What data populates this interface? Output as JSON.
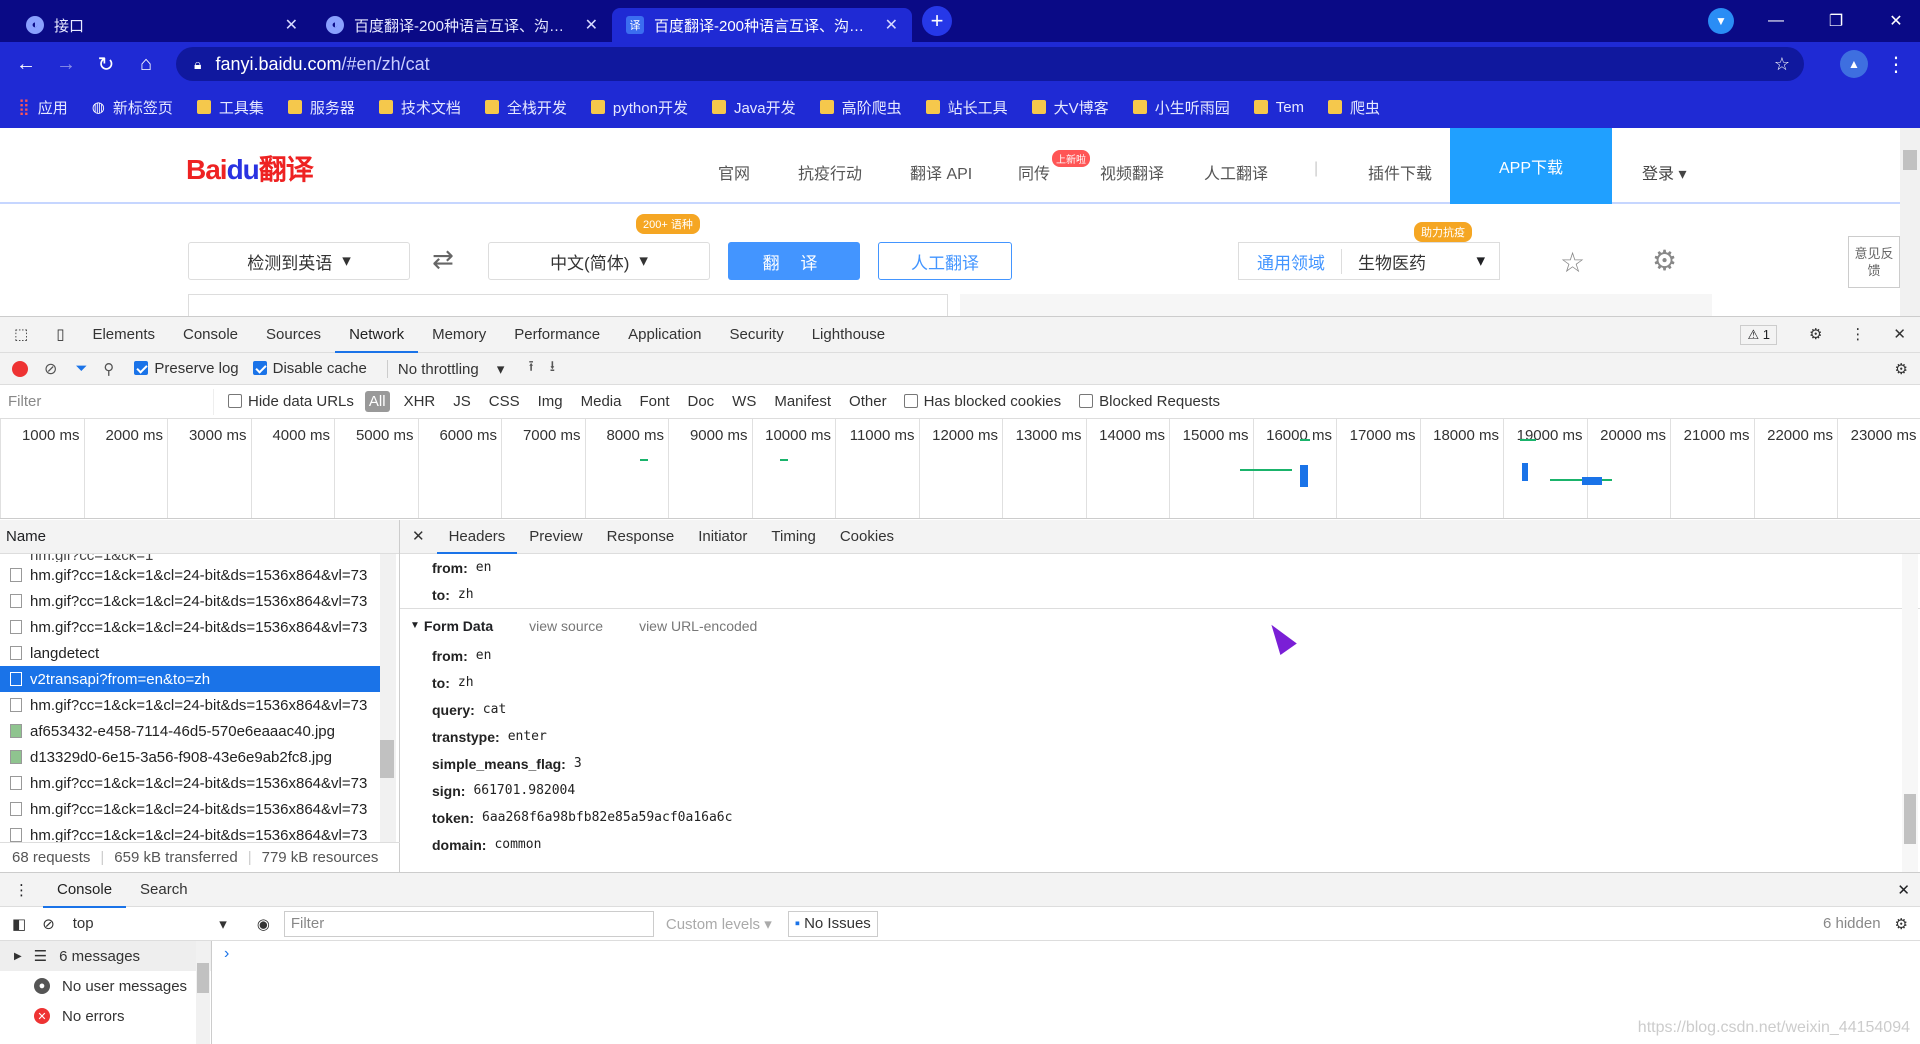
{
  "tabs": [
    {
      "title": "接口",
      "icon": "globe-icon"
    },
    {
      "title": "百度翻译-200种语言互译、沟通全世界",
      "icon": "globe-icon"
    },
    {
      "title": "百度翻译-200种语言互译、沟通全世界",
      "icon": "translate-favicon",
      "active": true
    }
  ],
  "address": {
    "host": "fanyi.baidu.com",
    "path": "/#en/zh/cat"
  },
  "bookmarks": [
    "应用",
    "新标签页",
    "工具集",
    "服务器",
    "技术文档",
    "全栈开发",
    "python开发",
    "Java开发",
    "高阶爬虫",
    "站长工具",
    "大V博客",
    "小生听雨园",
    "Tem",
    "爬虫"
  ],
  "site": {
    "logo_bai": "Bai",
    "logo_du": "du",
    "logo_fanyi": "翻译",
    "nav": [
      "官网",
      "抗疫行动",
      "翻译 API",
      "同传",
      "视频翻译",
      "人工翻译",
      "插件下载"
    ],
    "hot_badge": "上新啦",
    "app_download": "APP下载",
    "login": "登录",
    "from_lang": "检测到英语",
    "to_lang": "中文(简体)",
    "lang_badge": "200+ 语种",
    "translate_btn": "翻 译",
    "human_btn": "人工翻译",
    "domain_label": "通用领域",
    "domain_value": "生物医药",
    "domain_badge": "助力抗疫",
    "feedback": "意见反馈"
  },
  "devtools": {
    "tabs": [
      "Elements",
      "Console",
      "Sources",
      "Network",
      "Memory",
      "Performance",
      "Application",
      "Security",
      "Lighthouse"
    ],
    "active_tab": "Network",
    "warnings": "1",
    "preserve_log": "Preserve log",
    "disable_cache": "Disable cache",
    "throttling": "No throttling",
    "filter_placeholder": "Filter",
    "hide_data_urls": "Hide data URLs",
    "types": [
      "All",
      "XHR",
      "JS",
      "CSS",
      "Img",
      "Media",
      "Font",
      "Doc",
      "WS",
      "Manifest",
      "Other"
    ],
    "has_blocked": "Has blocked cookies",
    "blocked_requests": "Blocked Requests",
    "ticks": [
      "1000 ms",
      "2000 ms",
      "3000 ms",
      "4000 ms",
      "5000 ms",
      "6000 ms",
      "7000 ms",
      "8000 ms",
      "9000 ms",
      "10000 ms",
      "11000 ms",
      "12000 ms",
      "13000 ms",
      "14000 ms",
      "15000 ms",
      "16000 ms",
      "17000 ms",
      "18000 ms",
      "19000 ms",
      "20000 ms",
      "21000 ms",
      "22000 ms",
      "23000 ms"
    ],
    "name_header": "Name",
    "requests": [
      {
        "name": "hm.gif?cc=1&ck=1&cl=24-bit&ds=1536x864&vl=73"
      },
      {
        "name": "hm.gif?cc=1&ck=1&cl=24-bit&ds=1536x864&vl=73"
      },
      {
        "name": "hm.gif?cc=1&ck=1&cl=24-bit&ds=1536x864&vl=73"
      },
      {
        "name": "langdetect"
      },
      {
        "name": "v2transapi?from=en&to=zh",
        "selected": true
      },
      {
        "name": "hm.gif?cc=1&ck=1&cl=24-bit&ds=1536x864&vl=73"
      },
      {
        "name": "af653432-e458-7114-46d5-570e6eaaac40.jpg",
        "img": true
      },
      {
        "name": "d13329d0-6e15-3a56-f908-43e6e9ab2fc8.jpg",
        "img": true
      },
      {
        "name": "hm.gif?cc=1&ck=1&cl=24-bit&ds=1536x864&vl=73"
      },
      {
        "name": "hm.gif?cc=1&ck=1&cl=24-bit&ds=1536x864&vl=73"
      },
      {
        "name": "hm.gif?cc=1&ck=1&cl=24-bit&ds=1536x864&vl=73"
      }
    ],
    "status": {
      "requests": "68 requests",
      "transferred": "659 kB transferred",
      "resources": "779 kB resources"
    },
    "detail_tabs": [
      "Headers",
      "Preview",
      "Response",
      "Initiator",
      "Timing",
      "Cookies"
    ],
    "query_params": [
      {
        "k": "from:",
        "v": "en"
      },
      {
        "k": "to:",
        "v": "zh"
      }
    ],
    "form_data_title": "Form Data",
    "view_source": "view source",
    "view_url_encoded": "view URL-encoded",
    "form_data": [
      {
        "k": "from:",
        "v": "en"
      },
      {
        "k": "to:",
        "v": "zh"
      },
      {
        "k": "query:",
        "v": "cat"
      },
      {
        "k": "transtype:",
        "v": "enter"
      },
      {
        "k": "simple_means_flag:",
        "v": "3"
      },
      {
        "k": "sign:",
        "v": "661701.982004"
      },
      {
        "k": "token:",
        "v": "6aa268f6a98bfb82e85a59acf0a16a6c"
      },
      {
        "k": "domain:",
        "v": "common"
      }
    ]
  },
  "drawer": {
    "tabs": [
      "Console",
      "Search"
    ],
    "context": "top",
    "filter": "Filter",
    "levels": "Custom levels",
    "issues": "No Issues",
    "hidden": "6 hidden",
    "sidebar": [
      {
        "label": "6 messages",
        "icon": "list-icon"
      },
      {
        "label": "No user messages",
        "icon": "user-icon"
      },
      {
        "label": "No errors",
        "icon": "error-icon"
      }
    ],
    "prompt": "›"
  },
  "watermark": "https://blog.csdn.net/weixin_44154094"
}
